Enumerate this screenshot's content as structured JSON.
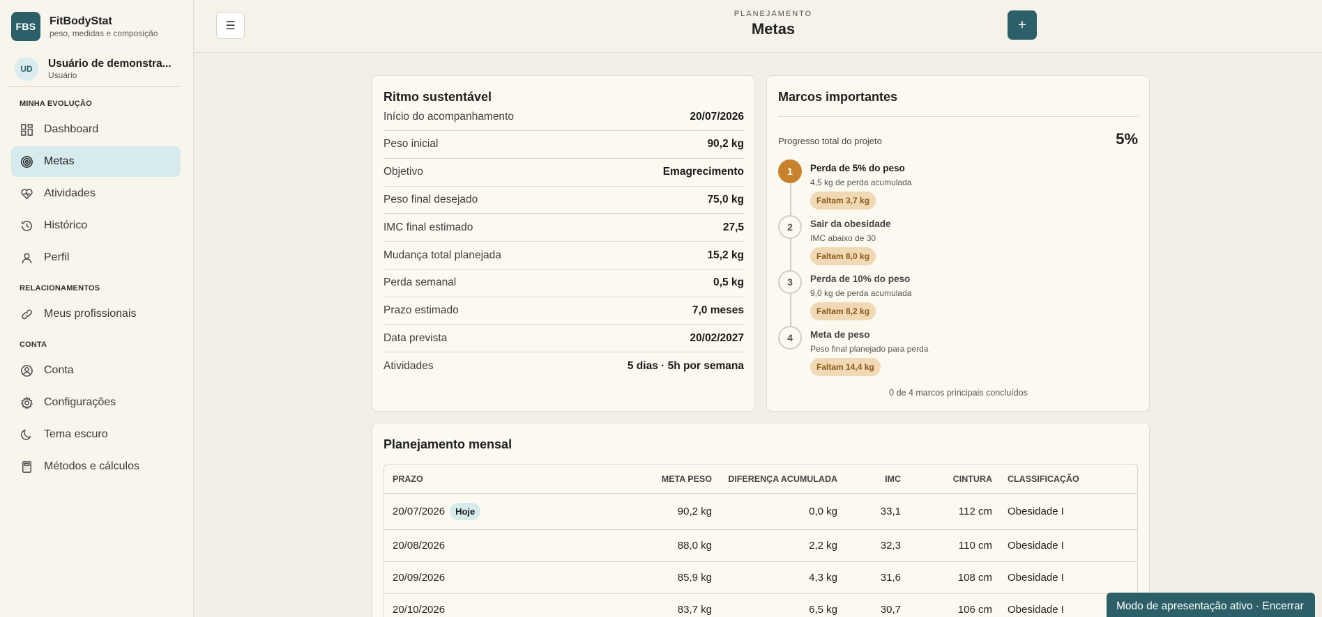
{
  "brand": {
    "logo": "FBS",
    "title": "FitBodyStat",
    "subtitle": "peso, medidas e composição"
  },
  "user": {
    "initials": "UD",
    "name": "Usuário de demonstra...",
    "role": "Usuário"
  },
  "sidebar": {
    "sections": [
      {
        "label": "MINHA EVOLUÇÃO"
      },
      {
        "label": "RELACIONAMENTOS"
      },
      {
        "label": "CONTA"
      }
    ],
    "items": [
      {
        "label": "Dashboard",
        "icon": "dashboard-icon"
      },
      {
        "label": "Metas",
        "icon": "target-icon",
        "active": true
      },
      {
        "label": "Atividades",
        "icon": "activity-icon"
      },
      {
        "label": "Histórico",
        "icon": "history-icon"
      },
      {
        "label": "Perfil",
        "icon": "user-icon"
      },
      {
        "label": "Meus profissionais",
        "icon": "link-icon"
      },
      {
        "label": "Conta",
        "icon": "account-icon"
      },
      {
        "label": "Configurações",
        "icon": "gear-icon"
      },
      {
        "label": "Tema escuro",
        "icon": "moon-icon"
      },
      {
        "label": "Métodos e cálculos",
        "icon": "calculator-icon"
      }
    ]
  },
  "header": {
    "kicker": "PLANEJAMENTO",
    "title": "Metas",
    "menu_icon": "☰",
    "add_icon": "+"
  },
  "pace": {
    "title": "Ritmo sustentável",
    "rows": [
      {
        "label": "Início do acompanhamento",
        "value": "20/07/2026"
      },
      {
        "label": "Peso inicial",
        "value": "90,2 kg"
      },
      {
        "label": "Objetivo",
        "value": "Emagrecimento"
      },
      {
        "label": "Peso final desejado",
        "value": "75,0 kg"
      },
      {
        "label": "IMC final estimado",
        "value": "27,5"
      },
      {
        "label": "Mudança total planejada",
        "value": "15,2 kg"
      },
      {
        "label": "Perda semanal",
        "value": "0,5 kg"
      },
      {
        "label": "Prazo estimado",
        "value": "7,0 meses"
      },
      {
        "label": "Data prevista",
        "value": "20/02/2027"
      },
      {
        "label": "Atividades",
        "value": "5 dias · 5h por semana"
      }
    ]
  },
  "milestones": {
    "title": "Marcos importantes",
    "progress_label": "Progresso total do projeto",
    "progress_value": "5%",
    "items": [
      {
        "num": "1",
        "title": "Perda de 5% do peso",
        "desc": "4,5 kg de perda acumulada",
        "badge": "Faltam 3,7 kg",
        "active": true
      },
      {
        "num": "2",
        "title": "Sair da obesidade",
        "desc": "IMC abaixo de 30",
        "badge": "Faltam 8,0 kg"
      },
      {
        "num": "3",
        "title": "Perda de 10% do peso",
        "desc": "9,0 kg de perda acumulada",
        "badge": "Faltam 8,2 kg"
      },
      {
        "num": "4",
        "title": "Meta de peso",
        "desc": "Peso final planejado para perda",
        "badge": "Faltam 14,4 kg"
      }
    ],
    "footer": "0 de 4 marcos principais concluídos"
  },
  "monthly": {
    "title": "Planejamento mensal",
    "columns": [
      "PRAZO",
      "META PESO",
      "DIFERENÇA ACUMULADA",
      "IMC",
      "CINTURA",
      "CLASSIFICAÇÃO"
    ],
    "today_label": "Hoje",
    "rows": [
      {
        "prazo": "20/07/2026",
        "meta": "90,2 kg",
        "dif": "0,0 kg",
        "imc": "33,1",
        "cintura": "112 cm",
        "class": "Obesidade I",
        "today": true
      },
      {
        "prazo": "20/08/2026",
        "meta": "88,0 kg",
        "dif": "2,2 kg",
        "imc": "32,3",
        "cintura": "110 cm",
        "class": "Obesidade I"
      },
      {
        "prazo": "20/09/2026",
        "meta": "85,9 kg",
        "dif": "4,3 kg",
        "imc": "31,6",
        "cintura": "108 cm",
        "class": "Obesidade I"
      },
      {
        "prazo": "20/10/2026",
        "meta": "83,7 kg",
        "dif": "6,5 kg",
        "imc": "30,7",
        "cintura": "106 cm",
        "class": "Obesidade I"
      }
    ]
  },
  "toast": {
    "text": "Modo de apresentação ativo · Encerrar"
  },
  "colors": {
    "accent": "#2c5f68",
    "milestone_active": "#c8822c",
    "badge_bg": "#f1d9b5",
    "active_nav": "#d6ebec"
  }
}
